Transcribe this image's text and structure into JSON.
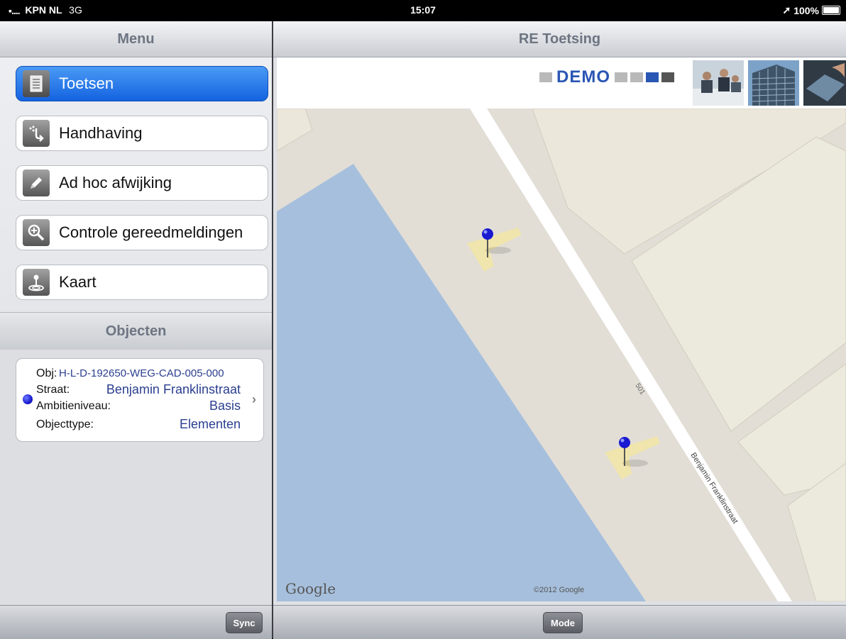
{
  "status_bar": {
    "carrier": "KPN NL",
    "network": "3G",
    "time": "15:07",
    "battery": "100%"
  },
  "left_header": {
    "title": "Menu"
  },
  "menu": {
    "items": [
      {
        "label": "Toetsen",
        "icon": "document-icon",
        "active": true
      },
      {
        "label": "Handhaving",
        "icon": "enforcement-icon",
        "active": false
      },
      {
        "label": "Ad hoc afwijking",
        "icon": "pencil-icon",
        "active": false
      },
      {
        "label": "Controle gereedmeldingen",
        "icon": "magnifier-icon",
        "active": false
      },
      {
        "label": "Kaart",
        "icon": "map-pin-icon",
        "active": false
      }
    ]
  },
  "objects": {
    "title": "Objecten",
    "card": {
      "obj_label": "Obj:",
      "obj_value": "H-L-D-192650-WEG-CAD-005-000",
      "straat_label": "Straat:",
      "straat_value": "Benjamin Franklinstraat",
      "ambitie_label": "Ambitieniveau:",
      "ambitie_value": "Basis",
      "objecttype_label": "Objecttype:",
      "objecttype_value": "Elementen"
    }
  },
  "left_toolbar": {
    "sync_label": "Sync"
  },
  "right_header": {
    "title": "RE Toetsing"
  },
  "banner": {
    "logo_text": "DEMO"
  },
  "map": {
    "google_label": "Google",
    "copyright": "©2012 Google",
    "road_label": "Benjamin Franklinstraat",
    "road_number": "501"
  },
  "right_toolbar": {
    "mode_label": "Mode"
  },
  "colors": {
    "active_blue": "#1463e0",
    "water": "#a6bfdc",
    "pin": "#1a1ad0"
  }
}
